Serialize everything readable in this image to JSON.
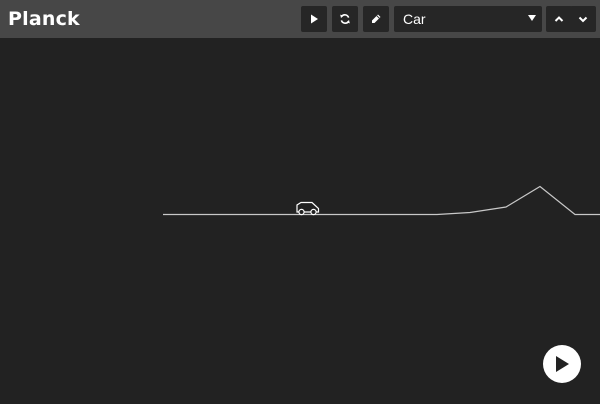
{
  "app": {
    "title": "Planck"
  },
  "toolbar": {
    "buttons": [
      {
        "name": "play",
        "icon": "play-icon"
      },
      {
        "name": "reload",
        "icon": "refresh-icon"
      },
      {
        "name": "edit",
        "icon": "pencil-icon"
      }
    ],
    "testbed_select": {
      "value": "Car",
      "icon": "caret-down-icon"
    },
    "prev_button": {
      "icon": "chevron-up-icon"
    },
    "next_button": {
      "icon": "chevron-down-icon"
    }
  },
  "stage": {
    "background": "#222222",
    "terrain_color": "#c8c8c8",
    "car_color": "#ffffff"
  },
  "play_overlay": {
    "icon": "play-icon"
  },
  "colors": {
    "topbar": "#474747",
    "button_bg": "#262626",
    "text": "#ffffff"
  }
}
